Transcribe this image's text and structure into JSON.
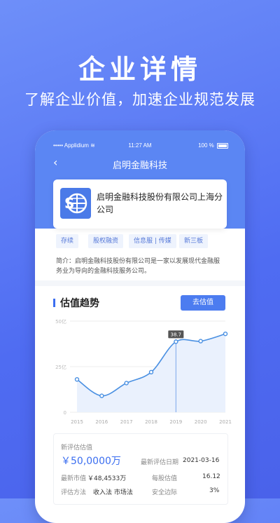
{
  "hero": {
    "title": "企业详情",
    "subtitle": "了解企业价值，加速企业规范发展"
  },
  "status_bar": {
    "carrier": "Applidium",
    "time": "11:27 AM",
    "battery": "100 %"
  },
  "nav": {
    "title": "启明金融科技"
  },
  "company": {
    "name": "启明金融科技股份有限公司上海分公司",
    "tags": [
      "存续",
      "股权融资",
      "信息服 | 传媒",
      "新三板"
    ],
    "intro": "简介：启明金融科技股份有限公司是一家以发展现代金融服务业为导向的金融科技服务公司。"
  },
  "section": {
    "title": "估值趋势",
    "button_label": "去估值"
  },
  "chart_data": {
    "type": "line",
    "x": [
      "2015",
      "2016",
      "2017",
      "2018",
      "2019",
      "2020",
      "2021"
    ],
    "values": [
      18,
      9,
      16,
      22,
      38.7,
      39,
      43
    ],
    "y_ticks": [
      "50亿",
      "25亿",
      "0"
    ],
    "ylim": [
      0,
      50
    ],
    "highlight": {
      "index": 4,
      "label": "38.7"
    },
    "line_color": "#4a90e2",
    "area_color": "#eaf1fd"
  },
  "stats": {
    "latest_label": "新评估估值",
    "latest_value": "￥50,0000万",
    "date_label": "最新评估日期",
    "date_value": "2021-03-16",
    "market_label": "最新市值",
    "market_value": "￥48,4533万",
    "per_share_label": "每股估值",
    "per_share_value": "16.12",
    "method_label": "评估方法",
    "method_value": "收入法 市场法",
    "margin_label": "安全边际",
    "margin_value": "3%"
  },
  "colors": {
    "brand": "#4f6cf2",
    "accent": "#3b6ef0"
  }
}
